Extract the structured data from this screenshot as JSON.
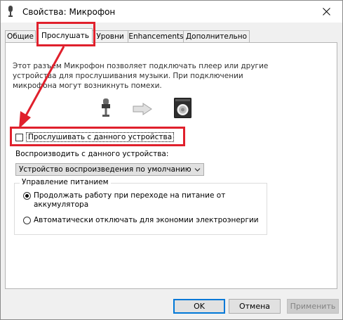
{
  "window": {
    "title": "Свойства: Микрофон",
    "title_icon": "microphone-icon",
    "close_icon": "close-icon"
  },
  "tabs": [
    {
      "label": "Общие",
      "active": false
    },
    {
      "label": "Прослушать",
      "active": true
    },
    {
      "label": "Уровни",
      "active": false
    },
    {
      "label": "Enhancements",
      "active": false
    },
    {
      "label": "Дополнительно",
      "active": false
    }
  ],
  "listen": {
    "description": "Этот разъем Микрофон позволяет подключать плеер или другие устройства для прослушивания музыки. При подключении микрофона могут возникнуть помехи.",
    "icons": [
      "microphone-icon",
      "arrow-right-icon",
      "speaker-icon"
    ],
    "checkbox_label": "Прослушивать с данного устройства",
    "checkbox_checked": false,
    "playback_label": "Воспроизводить с данного устройства:",
    "playback_value": "Устройство воспроизведения по умолчанию"
  },
  "power": {
    "legend": "Управление питанием",
    "options": [
      {
        "label": "Продолжать работу при переходе на питание от аккумулятора",
        "checked": true
      },
      {
        "label": "Автоматически отключать для экономии электроэнергии",
        "checked": false
      }
    ]
  },
  "buttons": {
    "ok": "OK",
    "cancel": "Отмена",
    "apply": "Применить"
  },
  "annotation": {
    "color": "#e0202c"
  }
}
